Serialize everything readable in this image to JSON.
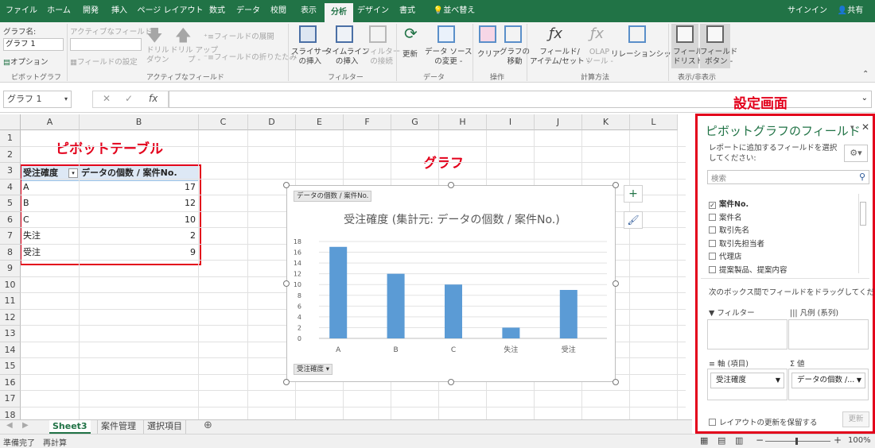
{
  "tabs": [
    "ファイル",
    "ホーム",
    "開発",
    "挿入",
    "ページ レイアウト",
    "数式",
    "データ",
    "校閲",
    "表示",
    "分析",
    "デザイン",
    "書式"
  ],
  "tell_me": "並べ替え",
  "signin": "サインイン",
  "share": "共有",
  "ribbon": {
    "chart_name_label": "グラフ名:",
    "chart_name_value": "グラフ 1",
    "options": "オプション",
    "active_field_label": "アクティブなフィールド:",
    "field_settings": "フィールドの設定",
    "drill_down_1": "ドリル",
    "drill_down_2": "ダウン",
    "drill_up_1": "ドリル アップ",
    "drill_up_2": "プ -",
    "expand_field": "フィールドの展開",
    "collapse_field": "フィールドの折りたたみ",
    "slicer_1": "スライサー",
    "slicer_2": "の挿入",
    "timeline_1": "タイムライン",
    "timeline_2": "の挿入",
    "filter_conn_1": "フィルター",
    "filter_conn_2": "の接続",
    "refresh": "更新",
    "change_source_1": "データ ソース",
    "change_source_2": "の変更 -",
    "clear": "クリア",
    "move_chart_1": "グラフの",
    "move_chart_2": "移動",
    "fields_items_1": "フィールド/",
    "fields_items_2": "アイテム/セット -",
    "olap_1": "OLAP",
    "olap_2": "ツール -",
    "relationships": "リレーションシップ",
    "field_list_1": "フィール",
    "field_list_2": "ドリスト",
    "field_buttons_1": "フィールド",
    "field_buttons_2": "ボタン -",
    "groups": {
      "pivotchart": "ピボットグラフ",
      "active_field": "アクティブなフィールド",
      "filter": "フィルター",
      "data": "データ",
      "actions": "操作",
      "calc": "計算方法",
      "show_hide": "表示/非表示"
    }
  },
  "name_box": "グラフ 1",
  "fx": "fx",
  "columns": [
    "A",
    "B",
    "C",
    "D",
    "E",
    "F",
    "G",
    "H",
    "I",
    "J",
    "K",
    "L"
  ],
  "rows": [
    "1",
    "2",
    "3",
    "4",
    "5",
    "6",
    "7",
    "8",
    "9",
    "10",
    "11",
    "12",
    "13",
    "14",
    "15",
    "16",
    "17",
    "18"
  ],
  "pivot": {
    "header_col1": "受注確度",
    "header_col2": "データの個数 / 案件No.",
    "rows": [
      {
        "label": "A",
        "value": "17"
      },
      {
        "label": "B",
        "value": "12"
      },
      {
        "label": "C",
        "value": "10"
      },
      {
        "label": "失注",
        "value": "2"
      },
      {
        "label": "受注",
        "value": "9"
      }
    ]
  },
  "annotations": {
    "pivot_table": "ピボットテーブル",
    "chart": "グラフ",
    "settings": "設定画面"
  },
  "chart_data": {
    "type": "bar",
    "title": "受注確度 (集計元: データの個数 / 案件No.)",
    "categories": [
      "A",
      "B",
      "C",
      "失注",
      "受注"
    ],
    "values": [
      17,
      12,
      10,
      2,
      9
    ],
    "ylim": [
      0,
      18
    ],
    "yticks": [
      "0",
      "2",
      "4",
      "6",
      "8",
      "10",
      "12",
      "14",
      "16",
      "18"
    ],
    "value_chip": "データの個数 / 案件No.",
    "axis_chip": "受注確度",
    "bar_color": "#5b9bd5",
    "grid": true
  },
  "sheets": [
    "Sheet3",
    "案件管理",
    "選択項目"
  ],
  "status": {
    "ready": "準備完了",
    "recalc": "再計算",
    "zoom": "100%"
  },
  "pane": {
    "title": "ピボットグラフのフィールド",
    "subtitle": "レポートに追加するフィールドを選択してください:",
    "search_placeholder": "検索",
    "fields": [
      {
        "name": "案件No.",
        "checked": true
      },
      {
        "name": "案件名",
        "checked": false
      },
      {
        "name": "取引先名",
        "checked": false
      },
      {
        "name": "取引先担当者",
        "checked": false
      },
      {
        "name": "代理店",
        "checked": false
      },
      {
        "name": "提案製品、提案内容",
        "checked": false
      }
    ],
    "drag_hint": "次のボックス間でフィールドをドラッグしてください:",
    "area_filter": "フィルター",
    "area_legend": "凡例 (系列)",
    "area_axis": "軸 (項目)",
    "area_values": "値",
    "axis_value": "受注確度",
    "values_value": "データの個数 /...",
    "defer_update": "レイアウトの更新を保留する",
    "update": "更新"
  },
  "colors": {
    "excel_green": "#217346",
    "annotation_red": "#e3001b"
  }
}
